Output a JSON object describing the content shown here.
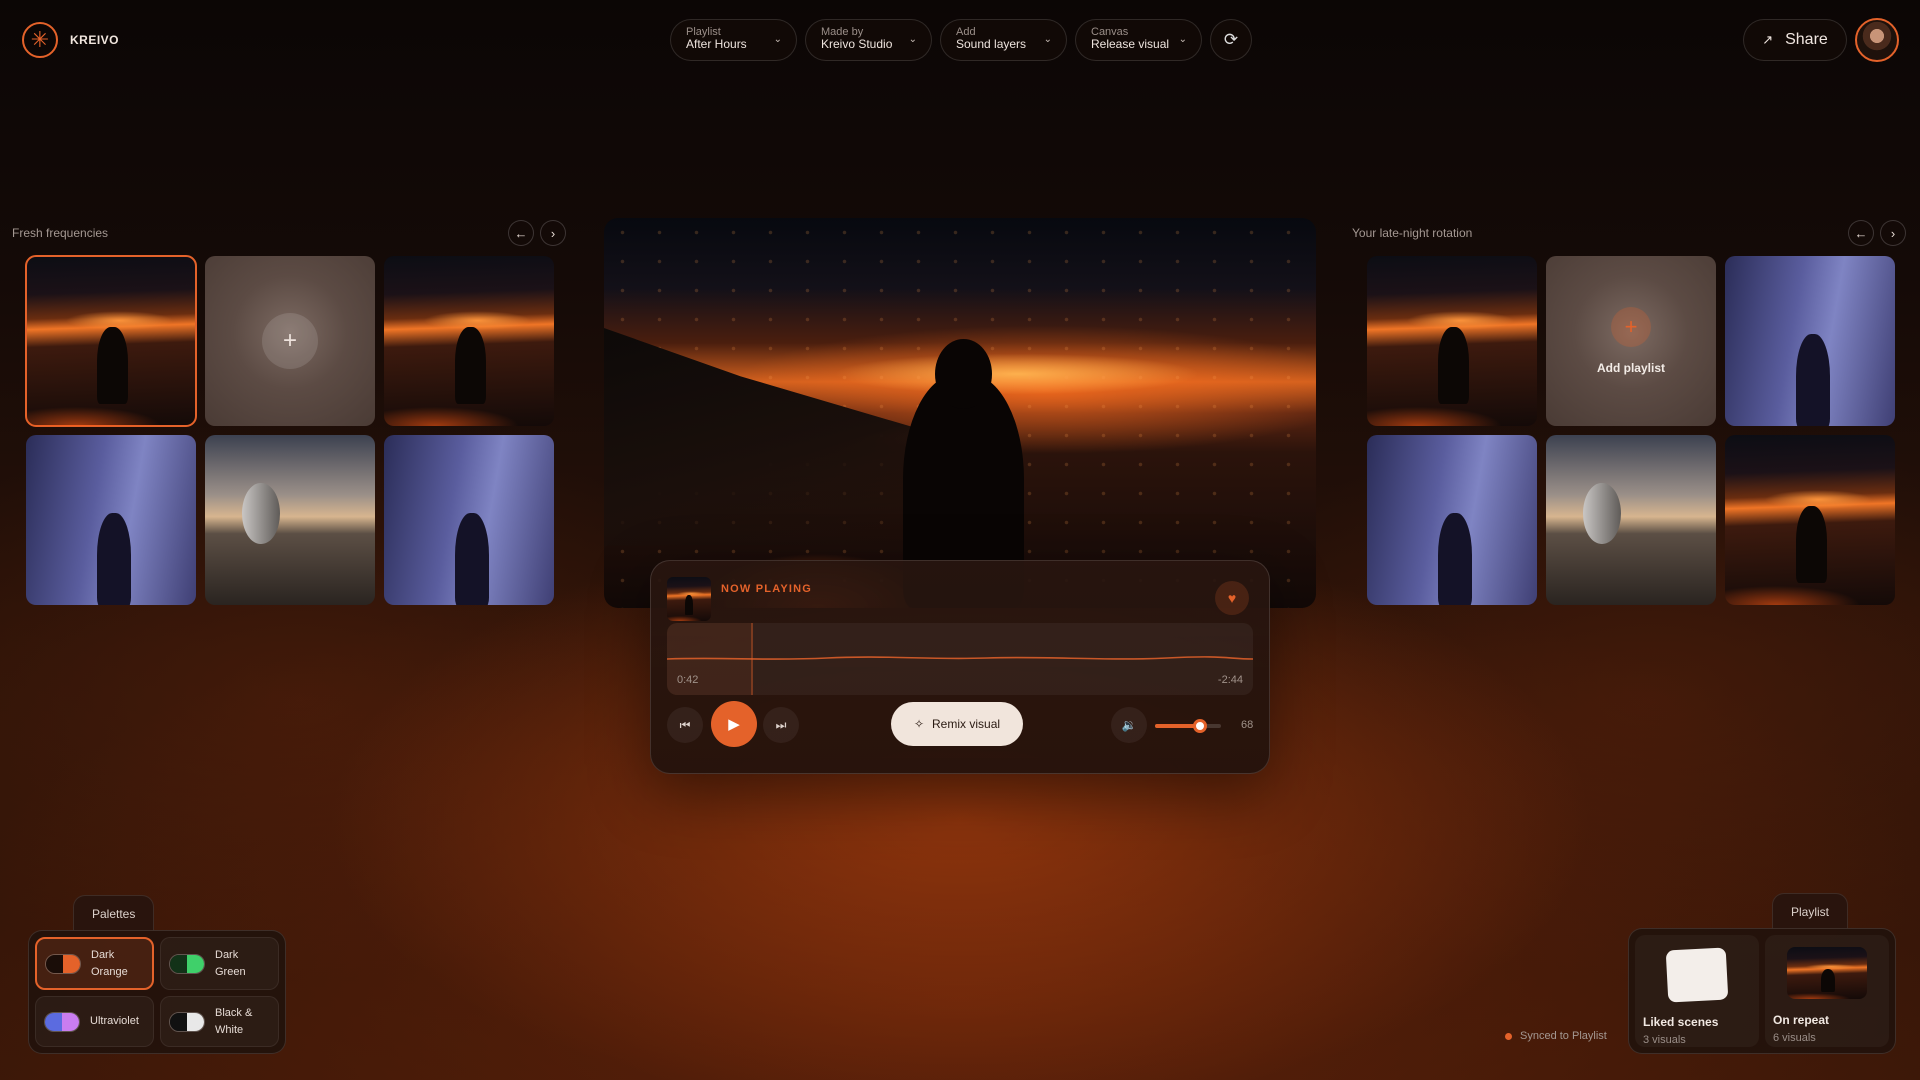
{
  "app": {
    "brand": "KREIVO",
    "logo_icon": "asterisk-logo-icon"
  },
  "header": {
    "pills": [
      {
        "label": "Playlist",
        "value": "After Hours"
      },
      {
        "label": "Made by",
        "value": "Kreivo Studio"
      },
      {
        "label": "Add",
        "value": "Sound layers"
      },
      {
        "label": "Canvas",
        "value": "Release visual"
      }
    ],
    "share_label": "Share"
  },
  "left_section": {
    "title": "Fresh frequencies",
    "tiles": [
      "sunset-coast",
      "add",
      "sunset-coast",
      "blue-corridor",
      "observatory",
      "blue-corridor"
    ]
  },
  "right_section": {
    "title": "Your late-night rotation",
    "add_label": "Add playlist",
    "tiles": [
      "sunset-coast",
      "add",
      "blue-corridor",
      "blue-corridor",
      "observatory",
      "sunset-coast"
    ]
  },
  "player": {
    "now_playing_label": "NOW PLAYING",
    "elapsed": "0:42",
    "remaining": "-2:44",
    "progress": 0.146,
    "remix_label": "Remix visual",
    "volume": 68,
    "volume_label": "68"
  },
  "palettes": {
    "title": "Palettes",
    "items": [
      {
        "label_line1": "Dark",
        "label_line2": "Orange",
        "colors": [
          "#1a0d08",
          "#e4622a"
        ],
        "active": true
      },
      {
        "label_line1": "Dark",
        "label_line2": "Green",
        "colors": [
          "#123218",
          "#3fd06a"
        ],
        "active": false
      },
      {
        "label_line1": "Ultraviolet",
        "label_line2": "",
        "colors": [
          "#5b6be0",
          "#c97df0"
        ],
        "active": false
      },
      {
        "label_line1": "Black &",
        "label_line2": "White",
        "colors": [
          "#111111",
          "#e8e8e8"
        ],
        "active": false
      }
    ]
  },
  "playlist_panel": {
    "title": "Playlist",
    "sync_text": "Synced to Playlist",
    "cards": [
      {
        "title": "Liked scenes",
        "subtitle": "3 visuals"
      },
      {
        "title": "On repeat",
        "subtitle": "6 visuals"
      }
    ]
  },
  "colors": {
    "accent": "#e4622a"
  }
}
